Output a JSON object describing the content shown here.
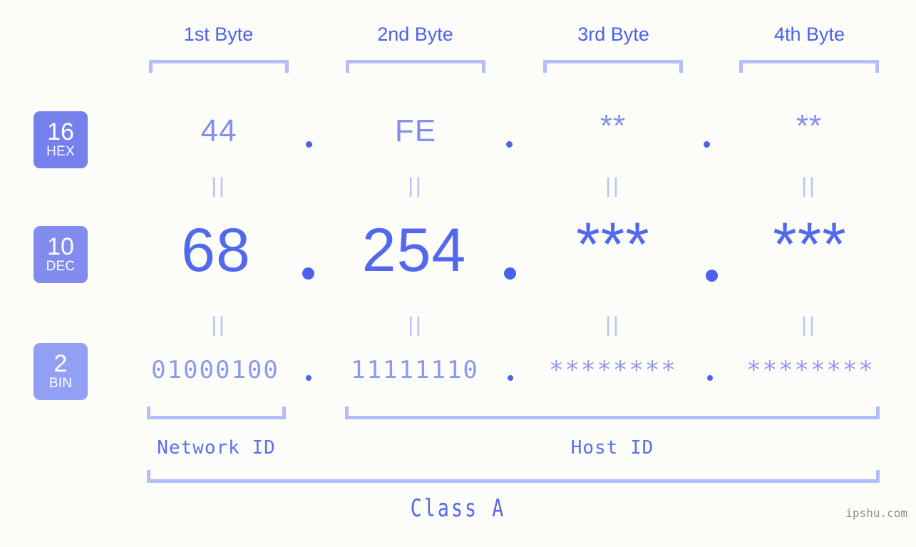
{
  "watermark": "ipshu.com",
  "class_label": "Class A",
  "bases": [
    {
      "number": "16",
      "name": "HEX",
      "color": "#7480ec"
    },
    {
      "number": "10",
      "name": "DEC",
      "color": "#828ced"
    },
    {
      "number": "2",
      "name": "BIN",
      "color": "#91a0f4"
    }
  ],
  "byte_headers": [
    {
      "label": "1st Byte"
    },
    {
      "label": "2nd Byte"
    },
    {
      "label": "3rd Byte"
    },
    {
      "label": "4th Byte"
    }
  ],
  "rows": {
    "hex": {
      "values": [
        "44",
        "FE",
        "**",
        "**"
      ],
      "separator": "."
    },
    "dec": {
      "values": [
        "68",
        "254",
        "***",
        "***"
      ],
      "separator": "."
    },
    "bin": {
      "values": [
        "01000100",
        "11111110",
        "********",
        "********"
      ],
      "separator": "."
    }
  },
  "equals": {
    "glyph": "||"
  },
  "id_sections": [
    {
      "label": "Network ID"
    },
    {
      "label": "Host ID"
    }
  ],
  "colors": {
    "background": "#fcfdf8",
    "accent_strong": "#4a62ef",
    "accent_dec": "#5268ef",
    "accent_hex": "#8590ee",
    "accent_bin": "#8d98f0",
    "bracket": "#b3bdf9",
    "equals": "#b9c2fa",
    "watermark": "#8d8d8d"
  }
}
